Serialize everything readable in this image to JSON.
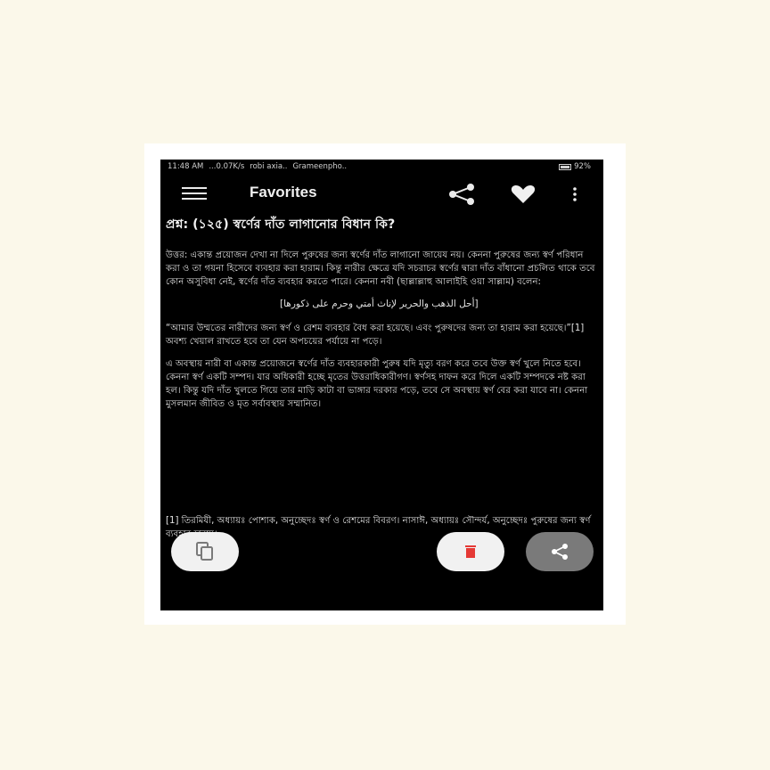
{
  "status_bar": {
    "time": "11:48 AM",
    "speed": "...0.07K/s",
    "carrier1": "robi axia..",
    "carrier2": "Grameenpho..",
    "battery": "92%"
  },
  "app_bar": {
    "title": "Favorites",
    "icons": [
      "menu-icon",
      "share-icon",
      "heart-icon",
      "more-vert-icon"
    ]
  },
  "question": "প্রশ্ন: (১২৫) স্বর্ণের দাঁত লাগানোর বিধান কি?",
  "answer_paragraphs": [
    "উত্তর: একান্ত প্রয়োজন দেখা না দিলে পুরুষের জন্য স্বর্ণের দাঁত লাগানো জায়েয নয়। কেননা পুরুষের জন্য স্বর্ণ পরিধান করা ও তা গয়না হিসেবে ব্যবহার করা হারাম। কিন্তু নারীর ক্ষেত্রে যদি সচরাচর স্বর্ণের দ্বারা দাঁত বাঁধানো প্রচলিত থাকে তবে কোন অসুবিধা নেই, স্বর্ণের দাঁত ব্যবহার করতে পারে। কেননা নবী (ছাল্লাল্লাহু আলাইহি ওয়া সাল্লাম) বলেন:",
    "[أحل الذهب والحرير لإناث أمتي وحرم على ذكورها]",
    "“আমার উম্মতের নারীদের জন্য স্বর্ণ ও রেশম ব্যবহার বৈধ করা হয়েছে। এবং পুরুষদের জন্য তা হারাম করা হয়েছে।”[1] অবশ্য খেয়াল রাখতে হবে তা যেন অপচয়ের পর্যায়ে না পড়ে।",
    "এ অবস্থায় নারী বা একান্ত প্রয়োজনে স্বর্ণের দাঁত ব্যবহারকারী পুরুষ যদি মৃত্যু বরণ করে তবে উক্ত স্বর্ণ খুলে নিতে হবে। কেননা স্বর্ণ একটি সম্পদ। যার অধিকারী হচ্ছে মৃতের উত্তরাধিকারীগণ। স্বর্ণসহ দাফন করে দিলে একটি সম্পদকে নষ্ট করা হল। কিন্তু যদি দাঁত খুলতে গিয়ে তার মাড়ি কাটা বা ভাঙ্গার দরকার পড়ে, তবে সে অবস্থায় স্বর্ণ বের করা যাবে না। কেননা মুসলমান জীবিত ও মৃত সর্বাবস্থায় সম্মানিত।"
  ],
  "footnote": "[1] তিরমিযী, অধ্যায়ঃ পোশাক, অনুচ্ছেদঃ স্বর্ণ ও রেশমের বিবরণ। নাসাঈ, অধ্যায়ঃ সৌন্দর্য, অনুচ্ছেদঃ পুরুষের জন্য স্বর্ণ ব্যবহার হারাম।",
  "fab_buttons": [
    {
      "name": "copy-icon",
      "color": "#f1f1f1"
    },
    {
      "name": "delete-icon",
      "color": "#f1f1f1",
      "icon_color": "#e53935"
    },
    {
      "name": "share-icon",
      "color": "#7a7a7a"
    }
  ],
  "colors": {
    "page_background": "#fbf8ea",
    "screen_background": "#000000",
    "text": "#e2e2e2",
    "delete_red": "#e53935"
  }
}
